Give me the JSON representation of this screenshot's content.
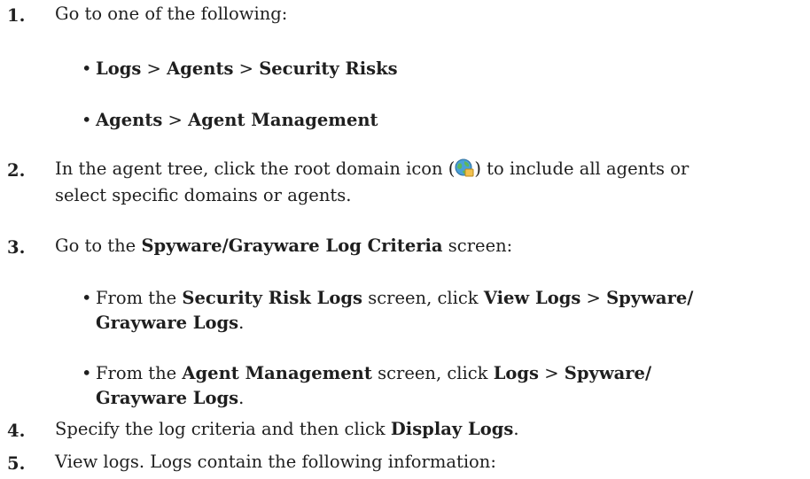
{
  "steps": [
    {
      "number": "1.",
      "text": "Go to one of the following:"
    },
    {
      "number": "2.",
      "line1_a": "In the agent tree, click the root domain icon (",
      "line1_b": ") to include all agents or",
      "line2": "select specific domains or agents."
    },
    {
      "number": "3.",
      "text_a": "Go to the ",
      "bold": "Spyware/Grayware Log Criteria",
      "text_b": " screen:"
    },
    {
      "number": "4.",
      "text_a": "Specify the log criteria and then click ",
      "bold": "Display Logs",
      "text_b": "."
    },
    {
      "number": "5.",
      "text": "View logs. Logs contain the following information:"
    }
  ],
  "step1_bullets": [
    {
      "b1": "Logs",
      "sep1": " > ",
      "b2": "Agents",
      "sep2": " > ",
      "b3": "Security Risks"
    },
    {
      "b1": "Agents",
      "sep1": " > ",
      "b2": "Agent Management"
    }
  ],
  "step3_bullets": [
    {
      "pre": "From the ",
      "b1": "Security Risk Logs",
      "mid": " screen, click ",
      "b2": "View Logs",
      "sep": " > ",
      "b3": "Spyware/",
      "b4": "Grayware Logs",
      "end": "."
    },
    {
      "pre": "From the ",
      "b1": "Agent Management",
      "mid": " screen, click ",
      "b2": "Logs",
      "sep": " > ",
      "b3": "Spyware/",
      "b4": "Grayware Logs",
      "end": "."
    }
  ],
  "bullet_glyph": "•",
  "icon": "root-domain-globe-icon"
}
